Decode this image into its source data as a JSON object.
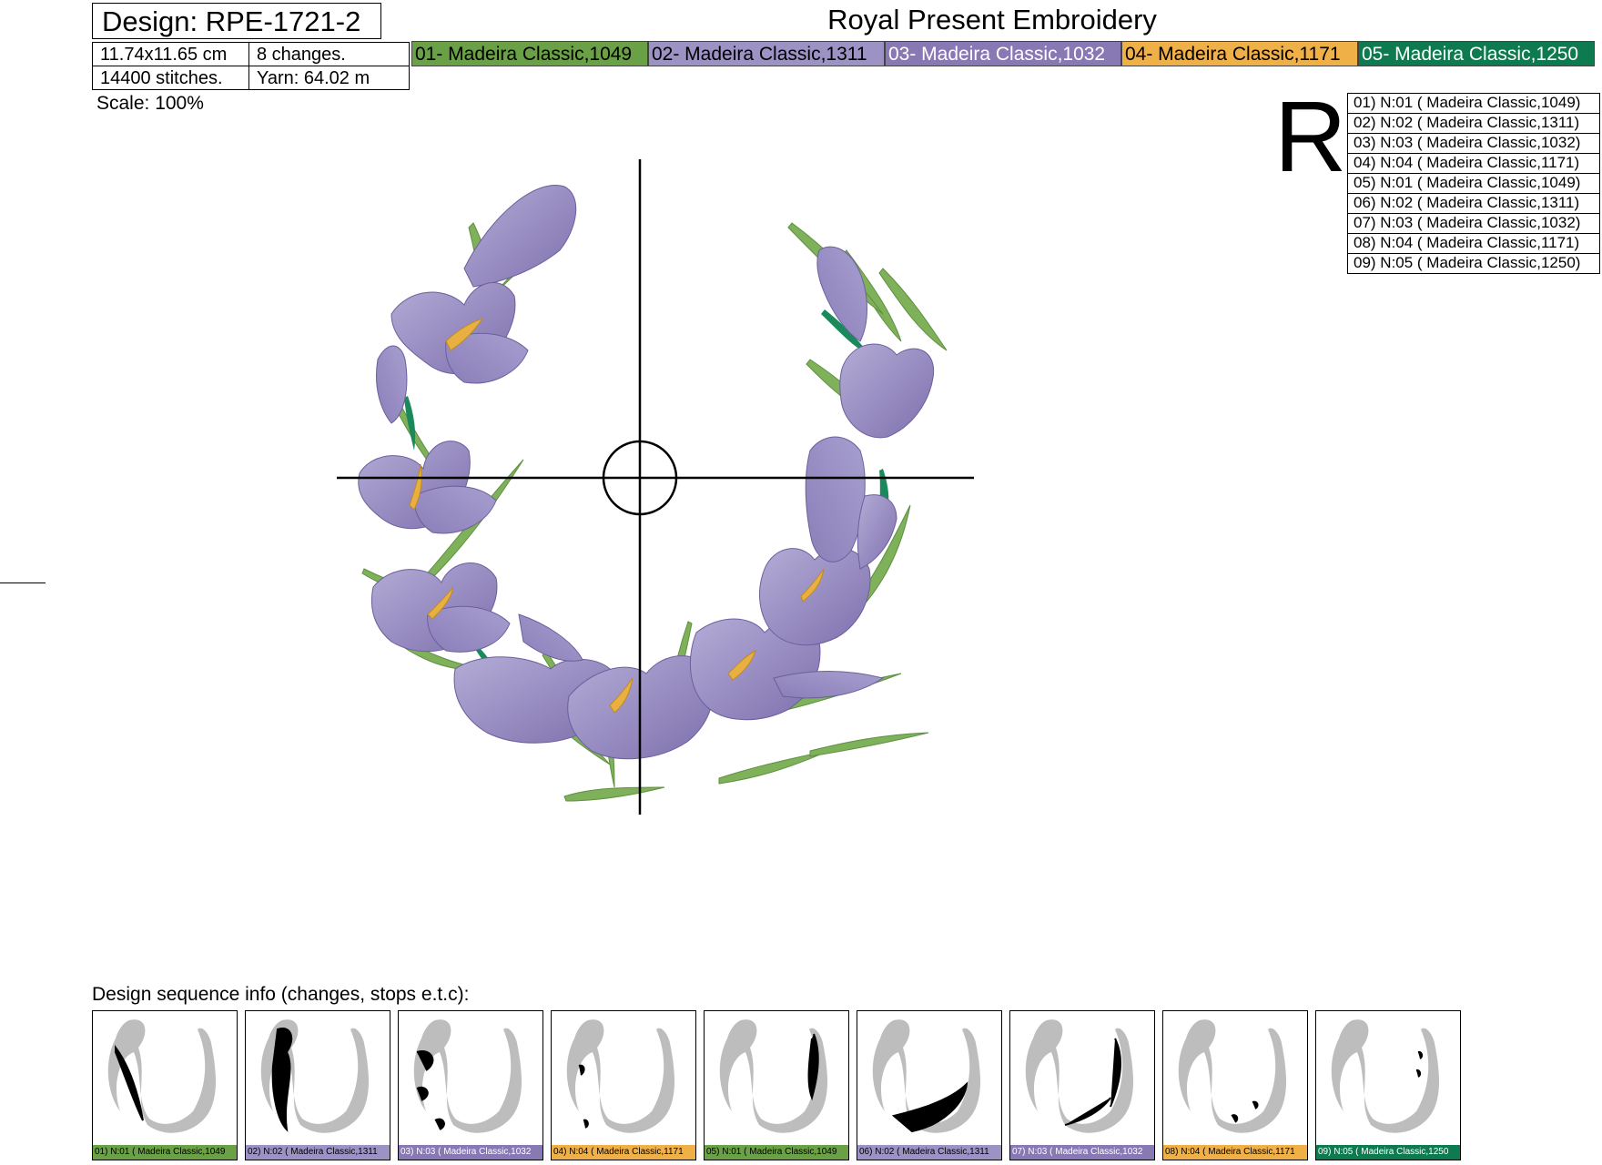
{
  "header": {
    "design_title": "Design: RPE-1721-2",
    "size": "11.74x11.65 cm",
    "changes": "8 changes.",
    "stitches": "14400 stitches.",
    "yarn": "Yarn: 64.02 m",
    "scale": "Scale: 100%",
    "brand": "Royal Present Embroidery"
  },
  "colors": [
    {
      "label": "01- Madeira Classic,1049",
      "hex": "#6aa046",
      "text": "dark"
    },
    {
      "label": "02- Madeira Classic,1311",
      "hex": "#9c92c4",
      "text": "dark"
    },
    {
      "label": "03- Madeira Classic,1032",
      "hex": "#8878b4",
      "text": "light"
    },
    {
      "label": "04- Madeira Classic,1171",
      "hex": "#f0b048",
      "text": "dark"
    },
    {
      "label": "05- Madeira Classic,1250",
      "hex": "#0e7a50",
      "text": "light"
    }
  ],
  "stops_title": "R",
  "stops": [
    "01) N:01 ( Madeira Classic,1049)",
    "02) N:02 ( Madeira Classic,1311)",
    "03) N:03 ( Madeira Classic,1032)",
    "04) N:04 ( Madeira Classic,1171)",
    "05) N:01 ( Madeira Classic,1049)",
    "06) N:02 ( Madeira Classic,1311)",
    "07) N:03 ( Madeira Classic,1032)",
    "08) N:04 ( Madeira Classic,1171)",
    "09) N:05 ( Madeira Classic,1250)"
  ],
  "sequence": {
    "title": "Design sequence info (changes, stops e.t.c):",
    "items": [
      {
        "label": "01) N:01 ( Madeira Classic,1049",
        "hex": "#6aa046",
        "text": "dark"
      },
      {
        "label": "02) N:02 ( Madeira Classic,1311",
        "hex": "#9c92c4",
        "text": "dark"
      },
      {
        "label": "03) N:03 ( Madeira Classic,1032",
        "hex": "#8878b4",
        "text": "light"
      },
      {
        "label": "04) N:04 ( Madeira Classic,1171",
        "hex": "#f0b048",
        "text": "dark"
      },
      {
        "label": "05) N:01 ( Madeira Classic,1049",
        "hex": "#6aa046",
        "text": "dark"
      },
      {
        "label": "06) N:02 ( Madeira Classic,1311",
        "hex": "#9c92c4",
        "text": "dark"
      },
      {
        "label": "07) N:03 ( Madeira Classic,1032",
        "hex": "#8878b4",
        "text": "light"
      },
      {
        "label": "08) N:04 ( Madeira Classic,1171",
        "hex": "#f0b048",
        "text": "dark"
      },
      {
        "label": "09) N:05 ( Madeira Classic,1250",
        "hex": "#0e7a50",
        "text": "light"
      }
    ]
  }
}
